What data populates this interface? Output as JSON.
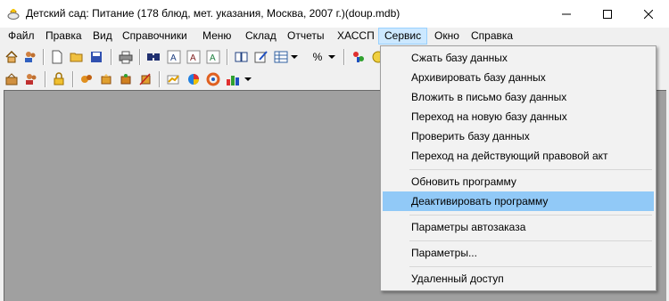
{
  "window": {
    "title": "Детский сад: Питание (178 блюд, мет. указания, Москва, 2007 г.)(doup.mdb)"
  },
  "menubar": {
    "items": [
      {
        "label": "Файл"
      },
      {
        "label": "Правка"
      },
      {
        "label": "Вид"
      },
      {
        "label": "Справочники"
      },
      {
        "label": "Меню"
      },
      {
        "label": "Склад"
      },
      {
        "label": "Отчеты"
      },
      {
        "label": "ХАССП"
      },
      {
        "label": "Сервис",
        "active": true
      },
      {
        "label": "Окно"
      },
      {
        "label": "Справка"
      }
    ]
  },
  "toolbar": {
    "percent_label": "%"
  },
  "service_menu": {
    "items": [
      {
        "label": "Сжать базу данных"
      },
      {
        "label": "Архивировать базу данных"
      },
      {
        "label": "Вложить в письмо базу данных"
      },
      {
        "label": "Переход на новую базу данных"
      },
      {
        "label": "Проверить базу данных"
      },
      {
        "label": "Переход на действующий правовой акт"
      },
      {
        "label": "Обновить программу"
      },
      {
        "label": "Деактивировать программу",
        "highlighted": true
      },
      {
        "label": "Параметры автозаказа"
      },
      {
        "label": "Параметры..."
      },
      {
        "label": "Удаленный доступ"
      }
    ],
    "highlight_color": "#91c9f7"
  }
}
